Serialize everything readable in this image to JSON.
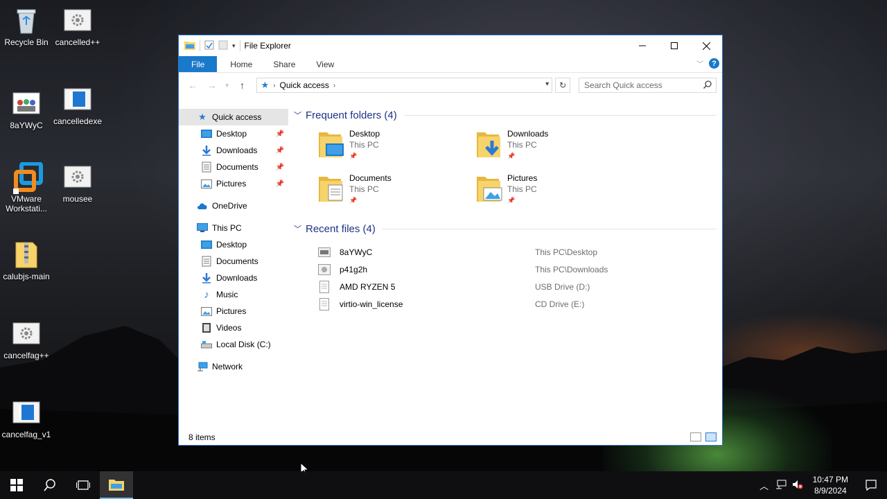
{
  "desktop": {
    "icons": [
      {
        "label": "Recycle Bin",
        "icon": "recycle-bin-icon"
      },
      {
        "label": "cancelled++",
        "icon": "gear-file-icon"
      },
      {
        "label": "8aYWyC",
        "icon": "image-file-icon"
      },
      {
        "label": "cancelledexe",
        "icon": "app-window-icon"
      },
      {
        "label": "VMware Workstati...",
        "icon": "vmware-icon"
      },
      {
        "label": "mousee",
        "icon": "gear-file-icon"
      },
      {
        "label": "calubjs-main",
        "icon": "zip-folder-icon"
      },
      {
        "label": "cancelfag++",
        "icon": "gear-file-icon"
      },
      {
        "label": "cancelfag_v1",
        "icon": "app-window-icon"
      }
    ]
  },
  "window": {
    "title": "File Explorer",
    "ribbon_tabs": [
      "File",
      "Home",
      "Share",
      "View"
    ],
    "help_label": "?",
    "address": {
      "location": "Quick access"
    },
    "search": {
      "placeholder": "Search Quick access"
    },
    "nav": {
      "quick_access": "Quick access",
      "quick_items": [
        "Desktop",
        "Downloads",
        "Documents",
        "Pictures"
      ],
      "onedrive": "OneDrive",
      "this_pc": "This PC",
      "pc_items": [
        "Desktop",
        "Documents",
        "Downloads",
        "Music",
        "Pictures",
        "Videos",
        "Local Disk (C:)"
      ],
      "network": "Network"
    },
    "frequent": {
      "header": "Frequent folders (4)",
      "folders": [
        {
          "name": "Desktop",
          "location": "This PC"
        },
        {
          "name": "Downloads",
          "location": "This PC"
        },
        {
          "name": "Documents",
          "location": "This PC"
        },
        {
          "name": "Pictures",
          "location": "This PC"
        }
      ]
    },
    "recent": {
      "header": "Recent files (4)",
      "files": [
        {
          "name": "8aYWyC",
          "location": "This PC\\Desktop"
        },
        {
          "name": "p41g2h",
          "location": "This PC\\Downloads"
        },
        {
          "name": "AMD RYZEN 5",
          "location": "USB Drive (D:)"
        },
        {
          "name": "virtio-win_license",
          "location": "CD Drive (E:)"
        }
      ]
    },
    "status": "8 items"
  },
  "taskbar": {
    "time": "10:47 PM",
    "date": "8/9/2024"
  },
  "colors": {
    "accent": "#1979ca",
    "header_text": "#1e3287",
    "folder_yellow": "#f7d36b"
  }
}
